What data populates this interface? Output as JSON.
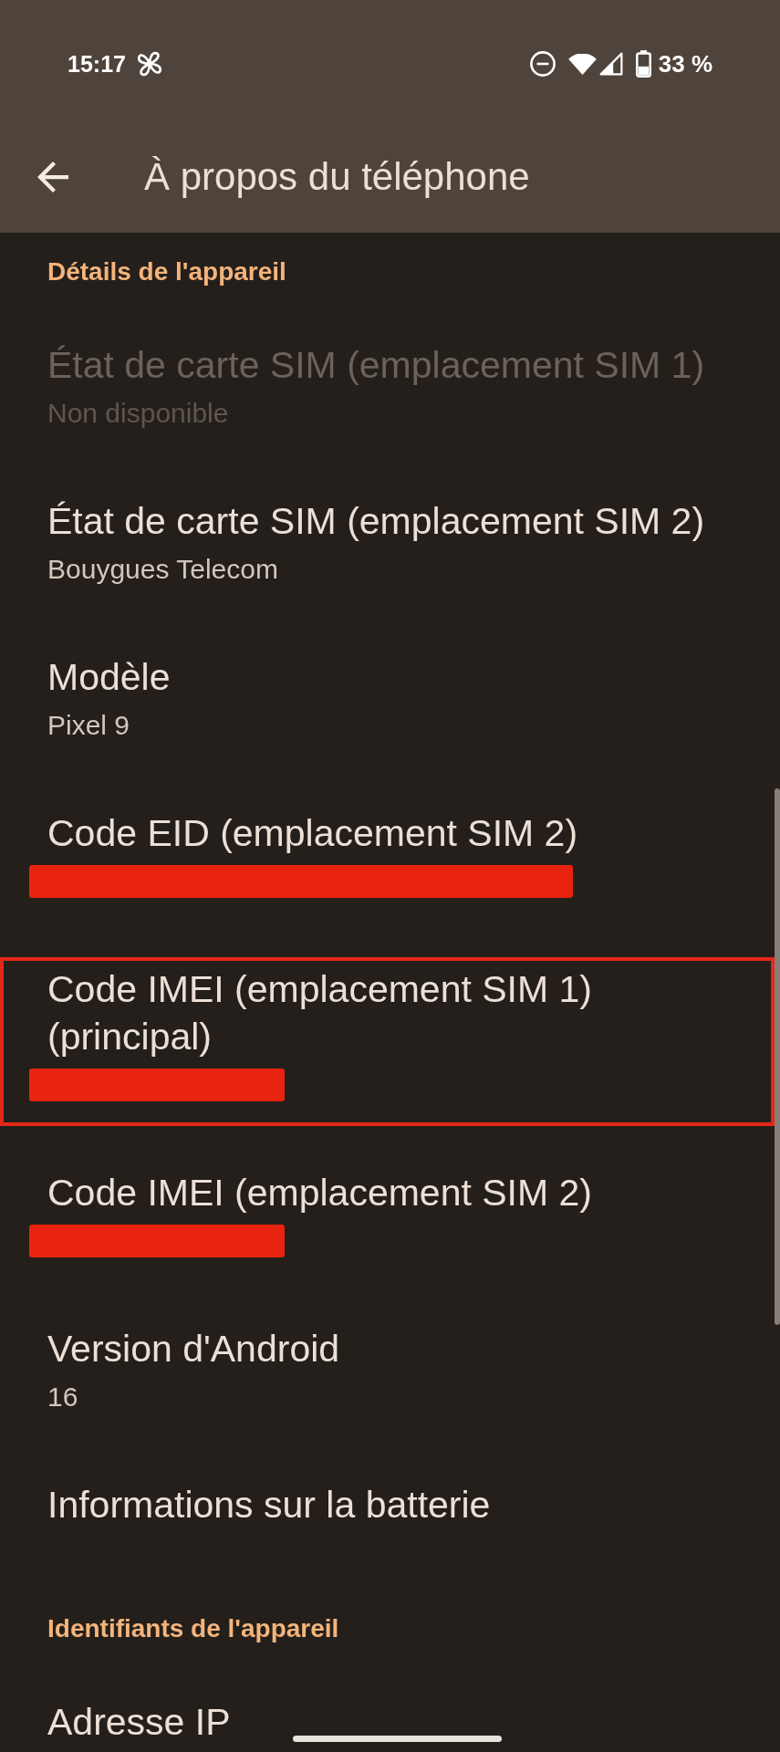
{
  "status_bar": {
    "time": "15:17",
    "battery_text": "33 %"
  },
  "app_bar": {
    "title": "À propos du téléphone"
  },
  "sections": [
    {
      "header": "Détails de l'appareil",
      "items": [
        {
          "kind": "text",
          "title": "État de carte SIM (emplacement SIM 1)",
          "summary": "Non disponible",
          "disabled": true,
          "highlighted": false
        },
        {
          "kind": "text",
          "title": "État de carte SIM (emplacement SIM 2)",
          "summary": "Bouygues Telecom",
          "disabled": false,
          "highlighted": false
        },
        {
          "kind": "text",
          "title": "Modèle",
          "summary": "Pixel 9",
          "disabled": false,
          "highlighted": false
        },
        {
          "kind": "redacted_long",
          "title": "Code EID (emplacement SIM 2)",
          "disabled": false,
          "highlighted": false
        },
        {
          "kind": "redacted_short",
          "title": "Code IMEI (emplacement SIM 1) (principal)",
          "disabled": false,
          "highlighted": true
        },
        {
          "kind": "redacted_short",
          "title": "Code IMEI (emplacement SIM 2)",
          "disabled": false,
          "highlighted": false
        },
        {
          "kind": "text",
          "title": "Version d'Android",
          "summary": "16",
          "disabled": false,
          "highlighted": false
        },
        {
          "kind": "text",
          "title": "Informations sur la batterie",
          "disabled": false,
          "highlighted": false
        }
      ]
    },
    {
      "header": "Identifiants de l'appareil",
      "items": [
        {
          "kind": "text",
          "title": "Adresse IP",
          "disabled": false,
          "highlighted": false
        }
      ]
    }
  ]
}
